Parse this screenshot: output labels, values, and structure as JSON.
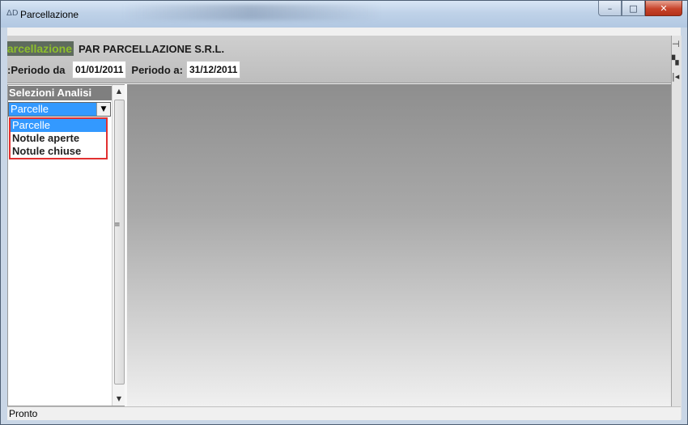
{
  "window": {
    "title": "Parcellazione",
    "icon": "app-icon",
    "buttons": {
      "minimize": "–",
      "maximize": "□",
      "close": "✕"
    }
  },
  "header": {
    "app_name": "Parcellazione",
    "company": "PAR PARCELLAZIONE S.R.L.",
    "period_from_label": "Periodo da:",
    "period_from_value": "01/01/2011",
    "period_to_label": "Periodo a:",
    "period_to_value": "31/12/2011"
  },
  "toolbar_right": {
    "pin_icon": "⊣",
    "tool2_icon": "▚",
    "tool3_icon": "|◂"
  },
  "left_panel": {
    "title": "Selezioni Analisi",
    "combo_value": "Parcelle",
    "options": [
      "Parcelle",
      "Notule aperte",
      "Notule chiuse"
    ],
    "selected_index": 0
  },
  "status": {
    "text": "Pronto"
  },
  "colors": {
    "selection": "#3399ff",
    "highlight_border": "#e23030",
    "app_name_green": "#8dbe2c"
  }
}
